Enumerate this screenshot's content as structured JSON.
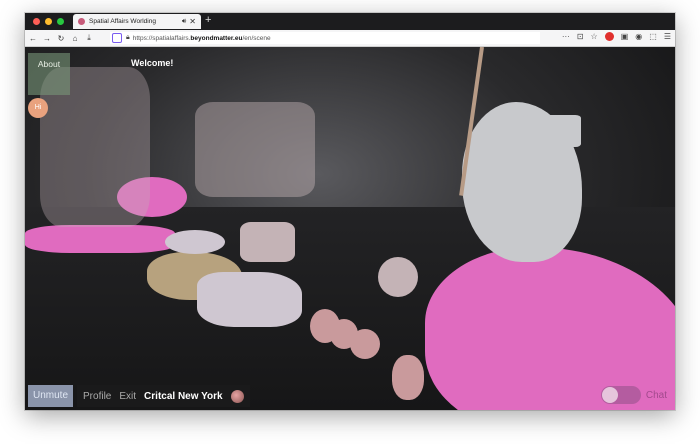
{
  "browser": {
    "tab_title": "Spatial Affairs Worlding",
    "audio_icon": "speaker-icon",
    "close_glyph": "✕",
    "new_tab_glyph": "+",
    "url_prefix": "https://spatialaffairs.",
    "url_host": "beyondmatter.eu",
    "url_path": "/en/scene",
    "menu_glyph": "☰"
  },
  "scene": {
    "about_label": "About",
    "welcome_text": "Welcome!",
    "avatar_label": "Hi",
    "unmute_label": "Unmute",
    "profile_label": "Profile",
    "exit_label": "Exit",
    "room_label": "Critcal New York",
    "chat_label": "Chat",
    "chat_enabled": false
  },
  "colors": {
    "accent_pink": "#e06bbf",
    "toggle_track": "#b45ca0",
    "unmute_bg": "#8a94aa"
  }
}
